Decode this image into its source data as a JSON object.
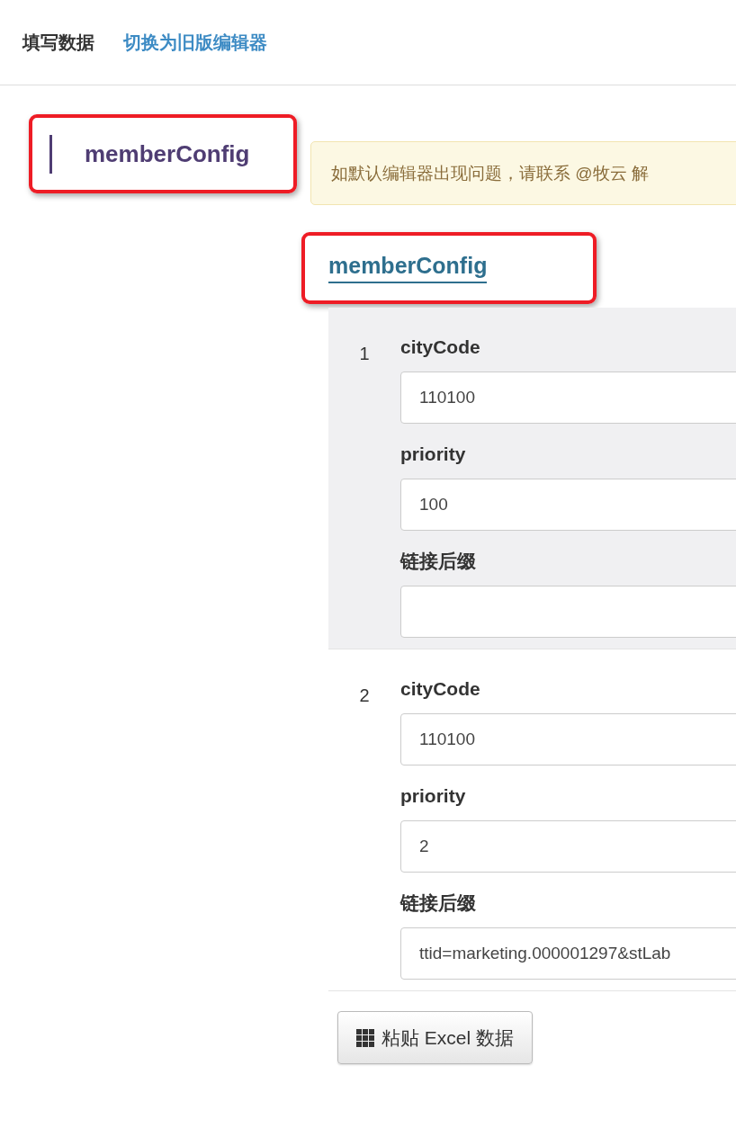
{
  "header": {
    "title": "填写数据",
    "link": "切换为旧版编辑器"
  },
  "sidebar": {
    "items": [
      {
        "label": "memberConfig",
        "selected": true,
        "highlighted": true
      }
    ]
  },
  "alert": {
    "text": "如默认编辑器出现问题，请联系 @牧云 解"
  },
  "section": {
    "title": "memberConfig",
    "highlighted": true,
    "rows": [
      {
        "index": "1",
        "selected": true,
        "fields": [
          {
            "label": "cityCode",
            "value": "110100"
          },
          {
            "label": "priority",
            "value": "100"
          },
          {
            "label": "链接后缀"
          }
        ]
      },
      {
        "index": "2",
        "selected": false,
        "fields": [
          {
            "label": "cityCode",
            "value": "110100"
          },
          {
            "label": "priority",
            "value": "2"
          },
          {
            "label": "链接后缀",
            "value": "ttid=marketing.000001297&stLab"
          }
        ]
      }
    ]
  },
  "paste_button": {
    "label": "粘贴 Excel 数据"
  }
}
